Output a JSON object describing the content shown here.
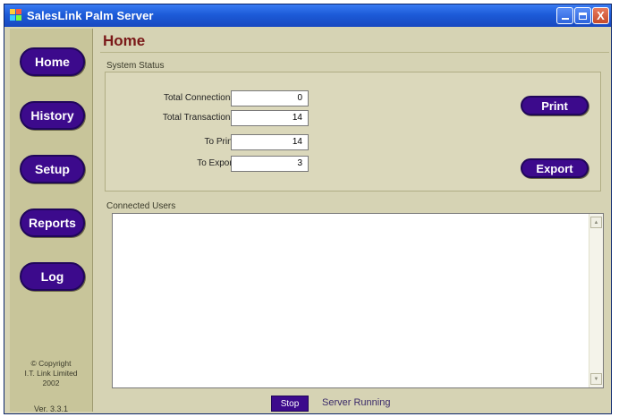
{
  "window": {
    "title": "SalesLink Palm Server",
    "minimize_symbol": "",
    "maximize_symbol": "",
    "close_symbol": "X"
  },
  "sidebar": {
    "items": [
      {
        "label": "Home"
      },
      {
        "label": "History"
      },
      {
        "label": "Setup"
      },
      {
        "label": "Reports"
      },
      {
        "label": "Log"
      }
    ],
    "copyright_lines": [
      "© Copyright",
      "I.T. Link Limited",
      "2002"
    ],
    "version": "Ver. 3.3.1"
  },
  "main": {
    "page_title": "Home",
    "system_status": {
      "label": "System Status",
      "fields": [
        {
          "label": "Total Connections :",
          "value": "0"
        },
        {
          "label": "Total Transactions :",
          "value": "14"
        },
        {
          "label": "To Print :",
          "value": "14"
        },
        {
          "label": "To Export :",
          "value": "3"
        }
      ],
      "print_label": "Print",
      "export_label": "Export"
    },
    "connected_users": {
      "label": "Connected Users",
      "users": []
    },
    "stop_label": "Stop",
    "server_status": "Server Running"
  },
  "colors": {
    "accent": "#3c0a8c",
    "title_text": "#7a1818",
    "titlebar": "#1c5bd8",
    "background": "#d6d3b4"
  }
}
